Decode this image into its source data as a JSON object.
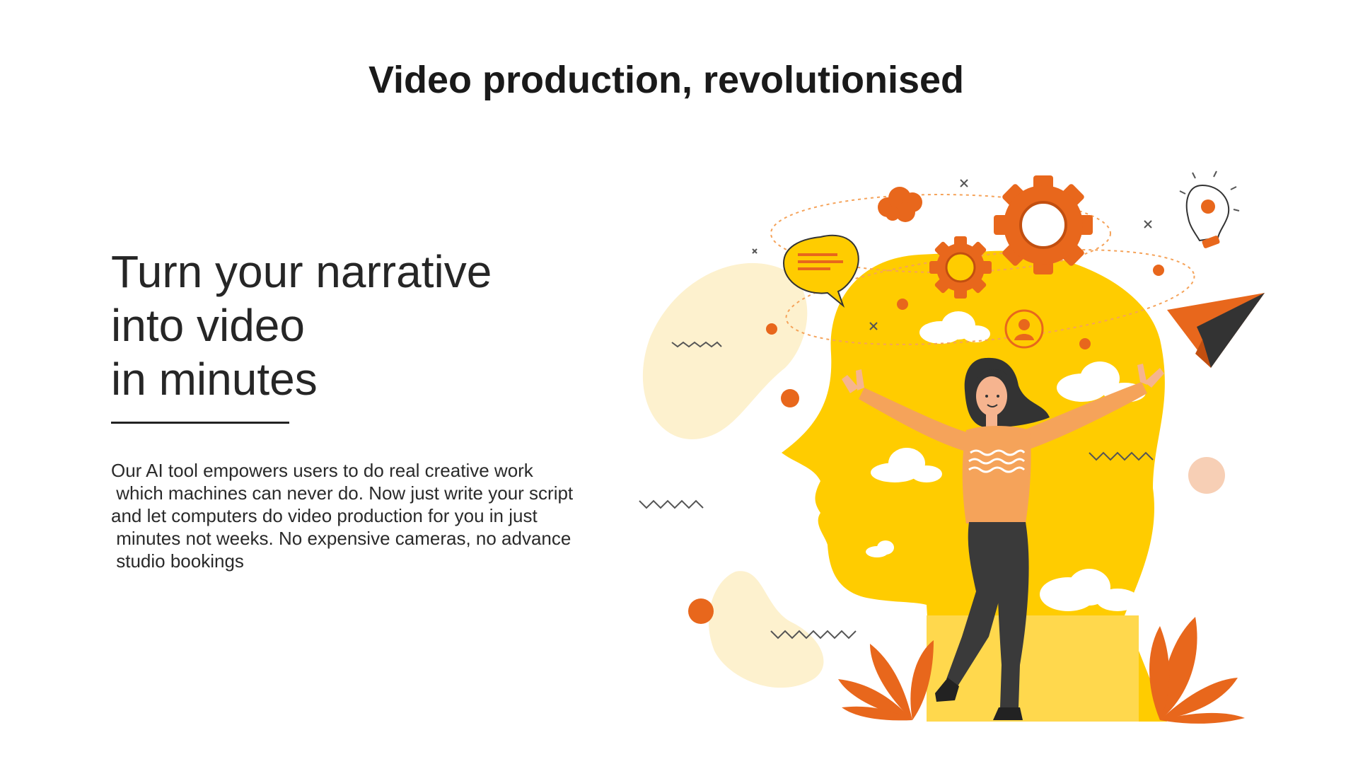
{
  "header": {
    "title": "Video production, revolutionised"
  },
  "hero": {
    "headline_lines": [
      "Turn your narrative",
      "into video",
      "in minutes"
    ],
    "body_lines": [
      "Our AI tool empowers users to do real creative work",
      " which machines can never do. Now just write your script",
      "and let computers do video production for you in just",
      " minutes not weeks. No expensive cameras, no advance",
      " studio bookings"
    ]
  },
  "illustration": {
    "colors": {
      "yellow": "#FFCC00",
      "orange": "#E8671C",
      "light_orange": "#F5A35A",
      "cream": "#FDF1CE",
      "peach": "#F7CFB5",
      "dark": "#3A3A3A",
      "skin": "#F6B48F"
    },
    "icons": [
      "cloud-icon",
      "gear-icon",
      "lightbulb-icon",
      "speech-bubble-icon",
      "user-icon",
      "paper-plane-icon",
      "leaf-icon"
    ]
  }
}
